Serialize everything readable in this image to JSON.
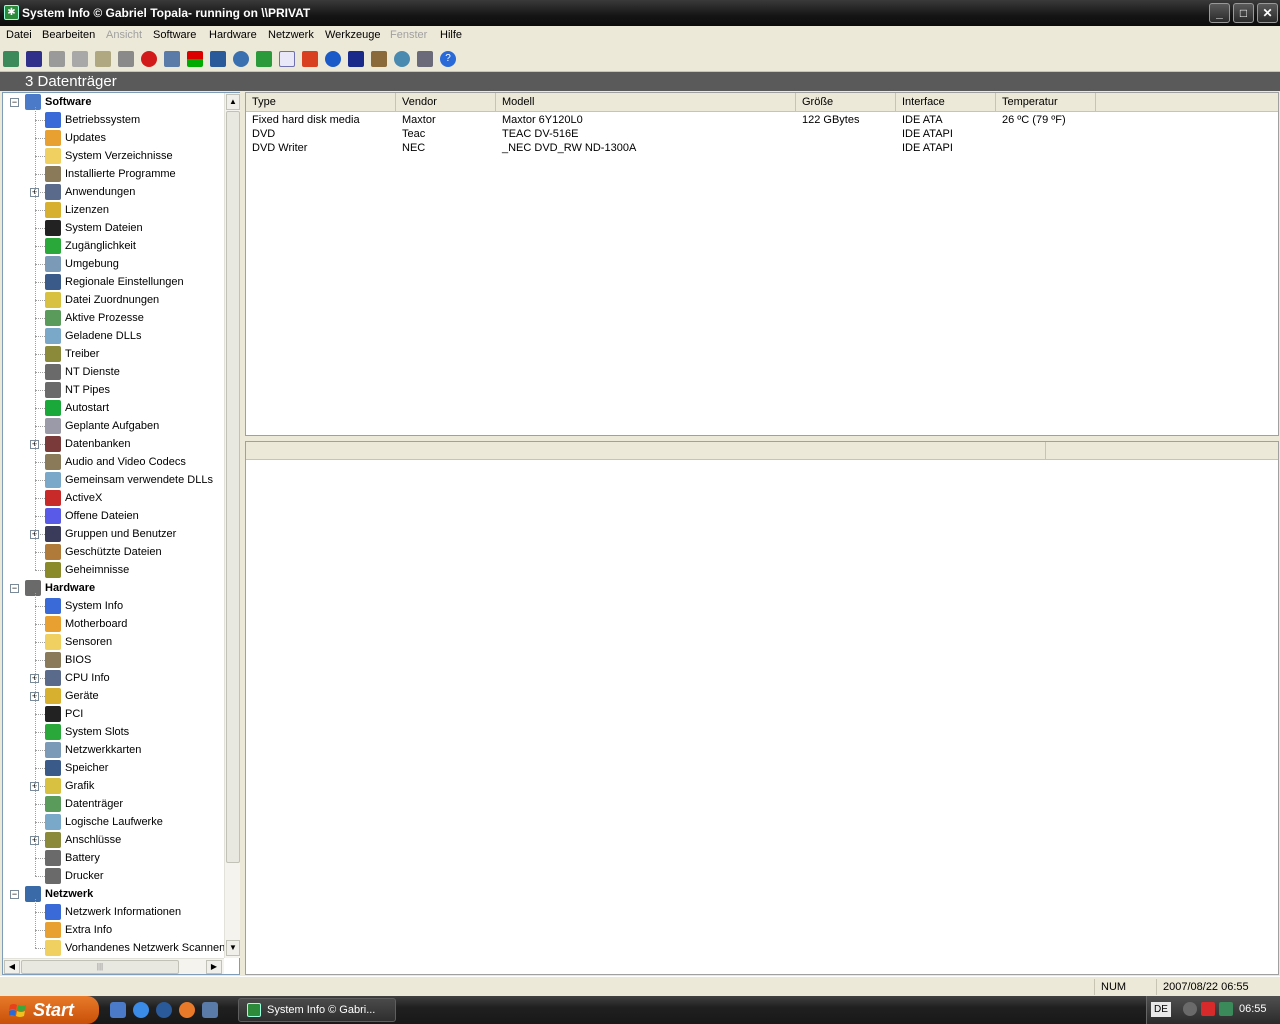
{
  "window": {
    "title": "System Info  © Gabriel Topala- running on \\\\PRIVAT",
    "buttons": {
      "minimize": "_",
      "maximize": "□",
      "close": "✕"
    }
  },
  "menu": [
    "Datei",
    "Bearbeiten",
    "Ansicht",
    "Software",
    "Hardware",
    "Netzwerk",
    "Werkzeuge",
    "Fenster",
    "Hilfe"
  ],
  "menu_disabled": [
    "Ansicht",
    "Fenster"
  ],
  "section_title": "3 Datenträger",
  "tree": {
    "software": {
      "label": "Software",
      "items": [
        "Betriebssystem",
        "Updates",
        "System Verzeichnisse",
        "Installierte Programme",
        "Anwendungen",
        "Lizenzen",
        "System Dateien",
        "Zugänglichkeit",
        "Umgebung",
        "Regionale Einstellungen",
        "Datei Zuordnungen",
        "Aktive Prozesse",
        "Geladene DLLs",
        "Treiber",
        "NT Dienste",
        "NT Pipes",
        "Autostart",
        "Geplante Aufgaben",
        "Datenbanken",
        "Audio and Video Codecs",
        "Gemeinsam verwendete DLLs",
        "ActiveX",
        "Offene Dateien",
        "Gruppen und Benutzer",
        "Geschützte Dateien",
        "Geheimnisse"
      ]
    },
    "hardware": {
      "label": "Hardware",
      "items": [
        "System Info",
        "Motherboard",
        "Sensoren",
        "BIOS",
        "CPU Info",
        "Geräte",
        "PCI",
        "System Slots",
        "Netzwerkkarten",
        "Speicher",
        "Grafik",
        "Datenträger",
        "Logische Laufwerke",
        "Anschlüsse",
        "Battery",
        "Drucker"
      ]
    },
    "netzwerk": {
      "label": "Netzwerk",
      "items": [
        "Netzwerk Informationen",
        "Extra Info",
        "Vorhandenes Netzwerk Scannen"
      ]
    }
  },
  "table": {
    "columns": [
      "Type",
      "Vendor",
      "Modell",
      "Größe",
      "Interface",
      "Temperatur"
    ],
    "rows": [
      [
        "Fixed hard disk media",
        "Maxtor",
        "Maxtor 6Y120L0",
        "122 GBytes",
        "IDE ATA",
        "26 ºC (79 ºF)"
      ],
      [
        "DVD",
        "Teac",
        "TEAC DV-516E",
        "",
        "IDE ATAPI",
        ""
      ],
      [
        "DVD Writer",
        "NEC",
        "_NEC DVD_RW ND-1300A",
        "",
        "IDE ATAPI",
        ""
      ]
    ]
  },
  "status": {
    "num": "NUM",
    "datetime": "2007/08/22 06:55"
  },
  "taskbar": {
    "start": "Start",
    "task_title": "System Info  © Gabri...",
    "lang": "DE",
    "clock": "06:55"
  },
  "colors": {
    "taskbar": "#202020",
    "start": "#d8641a",
    "section_bar": "#5a5a5a"
  }
}
